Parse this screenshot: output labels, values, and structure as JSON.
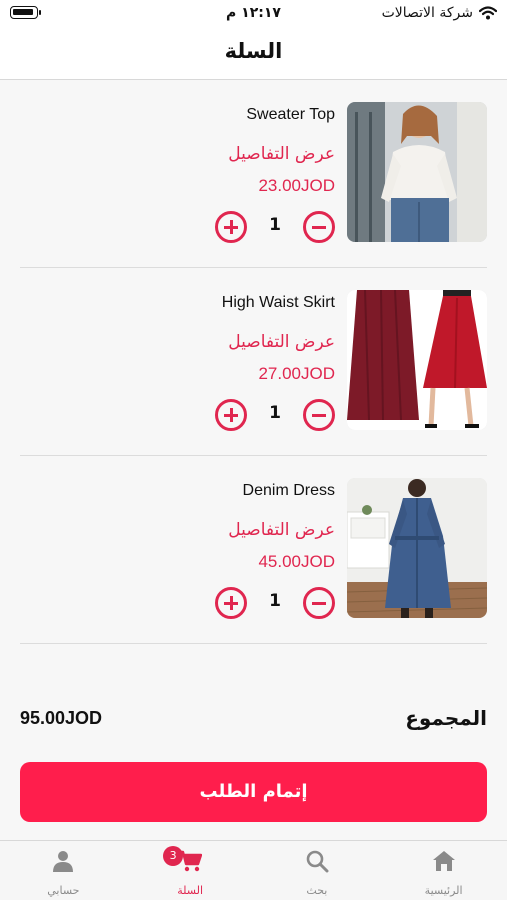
{
  "status_bar": {
    "time": "١٢:١٧ م",
    "carrier": "شركة الاتصالات"
  },
  "header": {
    "title": "السلة"
  },
  "cart": {
    "items": [
      {
        "name": "Sweater Top",
        "details_link": "عرض التفاصيل",
        "price": "23.00JOD",
        "quantity": "1"
      },
      {
        "name": "High Waist Skirt",
        "details_link": "عرض التفاصيل",
        "price": "27.00JOD",
        "quantity": "1"
      },
      {
        "name": "Denim Dress",
        "details_link": "عرض التفاصيل",
        "price": "45.00JOD",
        "quantity": "1"
      }
    ]
  },
  "summary": {
    "total_label": "المجموع",
    "total_value": "95.00JOD",
    "checkout_label": "إتمام الطلب"
  },
  "tabbar": {
    "tabs": [
      {
        "label": "الرئيسية",
        "icon": "home-icon"
      },
      {
        "label": "بحث",
        "icon": "search-icon"
      },
      {
        "label": "السلة",
        "icon": "cart-icon",
        "badge": "3"
      },
      {
        "label": "حسابي",
        "icon": "person-icon"
      }
    ]
  },
  "colors": {
    "accent": "#e0264f",
    "checkout_button": "#ff1e4c",
    "inactive_tab": "#8a8a8a"
  }
}
